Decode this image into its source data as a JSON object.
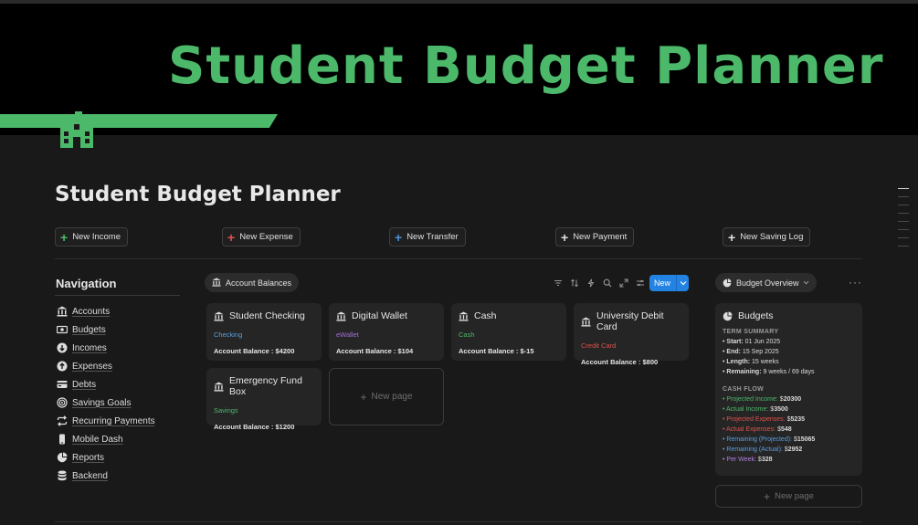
{
  "banner": {
    "title": "Student Budget Planner"
  },
  "page": {
    "title": "Student Budget Planner"
  },
  "actions": [
    {
      "label": "New Income",
      "color": "#4cb96a"
    },
    {
      "label": "New Expense",
      "color": "#e0524a"
    },
    {
      "label": "New Transfer",
      "color": "#4a90d9"
    },
    {
      "label": "New Payment",
      "color": "#e0e0e0"
    },
    {
      "label": "New Saving Log",
      "color": "#e0e0e0"
    }
  ],
  "navigation": {
    "title": "Navigation",
    "items": [
      {
        "label": "Accounts",
        "icon": "bank-icon"
      },
      {
        "label": "Budgets",
        "icon": "money-icon"
      },
      {
        "label": "Incomes",
        "icon": "arrow-down-circle-icon"
      },
      {
        "label": "Expenses",
        "icon": "arrow-up-circle-icon"
      },
      {
        "label": "Debts",
        "icon": "credit-card-icon"
      },
      {
        "label": "Savings Goals",
        "icon": "target-icon"
      },
      {
        "label": "Recurring Payments",
        "icon": "repeat-icon"
      },
      {
        "label": "Mobile Dash",
        "icon": "phone-icon"
      },
      {
        "label": "Reports",
        "icon": "pie-chart-icon"
      },
      {
        "label": "Backend",
        "icon": "database-icon"
      }
    ]
  },
  "gallery": {
    "view_label": "Account Balances",
    "new_label": "New",
    "new_page_label": "New page",
    "cards": [
      {
        "name": "Student Checking",
        "type": "Checking",
        "type_color": "#5a9fe0",
        "balance": "Account Balance : $4200"
      },
      {
        "name": "Digital Wallet",
        "type": "eWallet",
        "type_color": "#a270d8",
        "balance": "Account Balance : $104"
      },
      {
        "name": "Cash",
        "type": "Cash",
        "type_color": "#4cb96a",
        "balance": "Account Balance : $-15"
      },
      {
        "name": "University Debit Card",
        "type": "Credit Card",
        "type_color": "#e0524a",
        "balance": "Account Balance : $800"
      },
      {
        "name": "Emergency Fund Box",
        "type": "Savings",
        "type_color": "#4cb96a",
        "balance": "Account Balance : $1200"
      }
    ]
  },
  "budget_panel": {
    "view_label": "Budget Overview",
    "card_title": "Budgets",
    "new_page_label": "New page",
    "term_summary": {
      "title": "TERM SUMMARY",
      "lines": [
        {
          "label": "Start:",
          "value": "01 Jun 2025"
        },
        {
          "label": "End:",
          "value": "15 Sep 2025"
        },
        {
          "label": "Length:",
          "value": "15 weeks"
        },
        {
          "label": "Remaining:",
          "value": "9 weeks / 69 days"
        }
      ]
    },
    "cash_flow": {
      "title": "CASH FLOW",
      "lines": [
        {
          "label": "Projected Income:",
          "prefix": "$",
          "value": "20300",
          "color": "#4cb96a"
        },
        {
          "label": "Actual Income:",
          "prefix": "$",
          "value": "3500",
          "color": "#4cb96a"
        },
        {
          "label": "Projected Expenses:",
          "prefix": "$",
          "value": "5235",
          "color": "#e0524a"
        },
        {
          "label": "Actual Expenses:",
          "prefix": "$",
          "value": "548",
          "color": "#e0524a"
        },
        {
          "label": "Remaining (Projected):",
          "prefix": "$",
          "value": "15065",
          "color": "#5a9fe0"
        },
        {
          "label": "Remaining (Actual):",
          "prefix": "$",
          "value": "2952",
          "color": "#5a9fe0"
        },
        {
          "label": "Per Week:",
          "prefix": "$",
          "value": "328",
          "color": "#b27ee0"
        }
      ]
    }
  }
}
